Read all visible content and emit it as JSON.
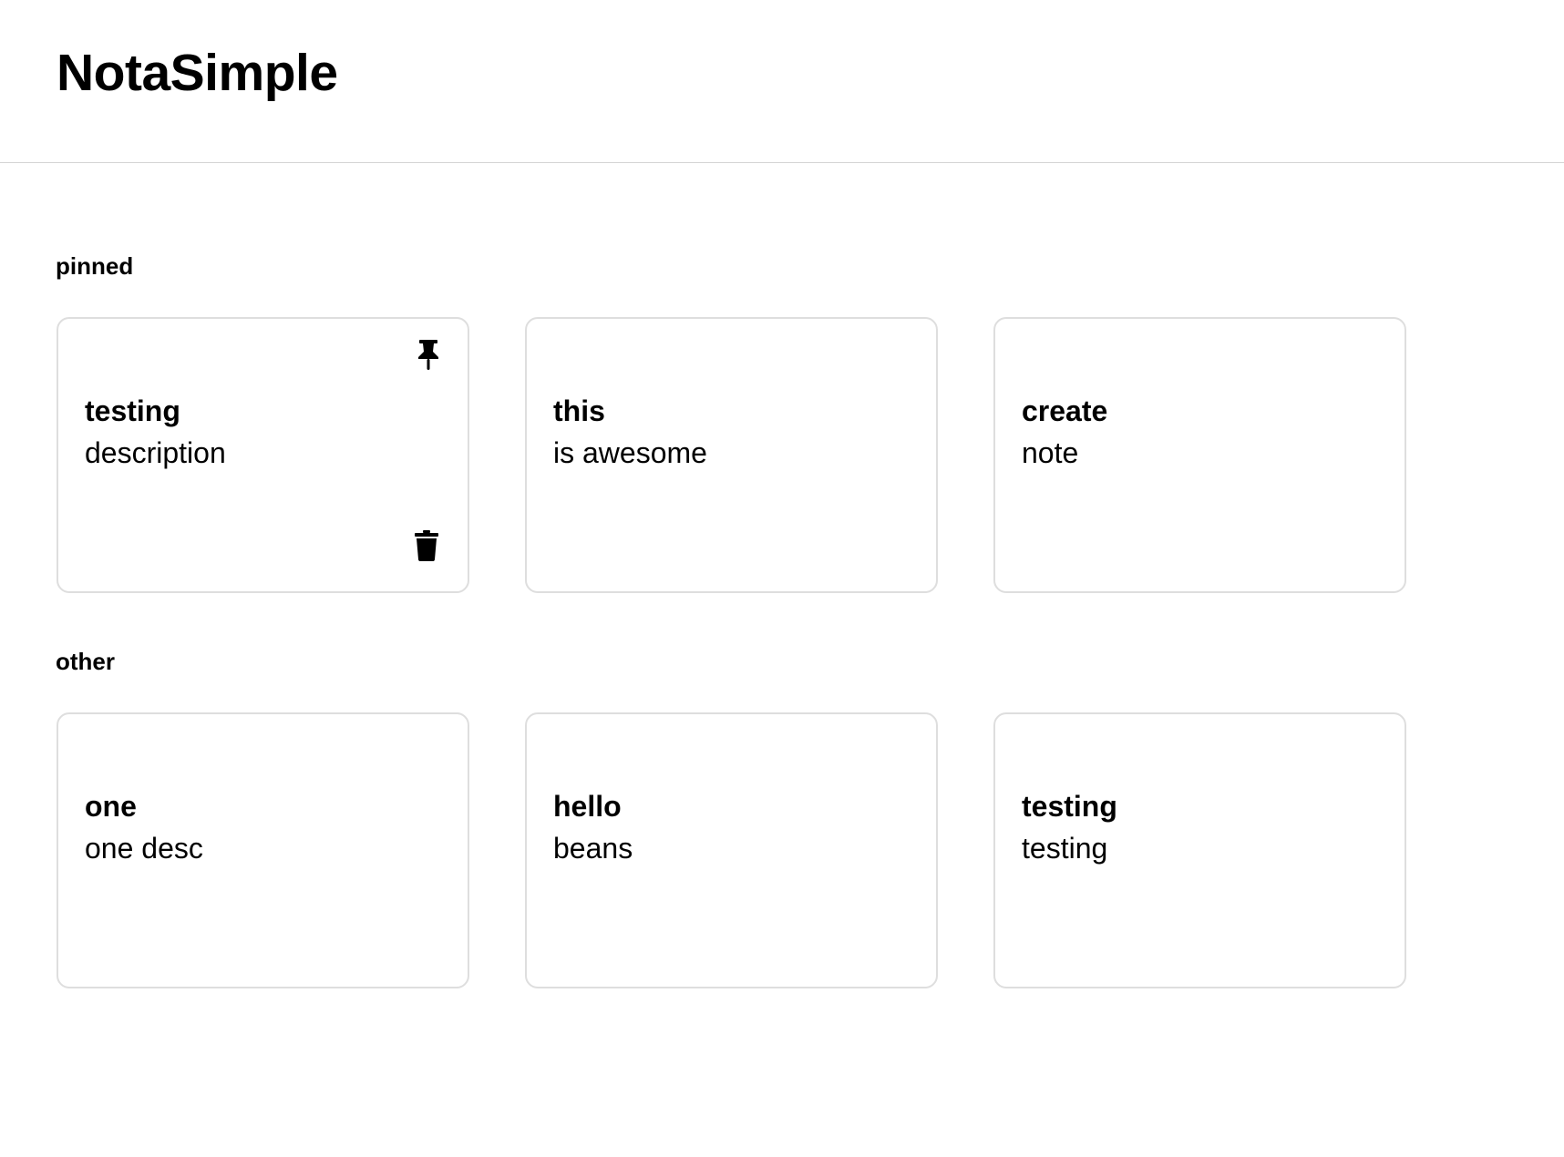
{
  "app": {
    "title": "NotaSimple"
  },
  "sections": {
    "pinned_label": "pinned",
    "other_label": "other"
  },
  "pinned_notes": [
    {
      "title": "testing",
      "description": "description"
    },
    {
      "title": "this",
      "description": "is awesome"
    },
    {
      "title": "create",
      "description": "note"
    }
  ],
  "other_notes": [
    {
      "title": "one",
      "description": "one desc"
    },
    {
      "title": "hello",
      "description": "beans"
    },
    {
      "title": "testing",
      "description": "testing"
    }
  ],
  "icons": {
    "pin": "pushpin-icon",
    "trash": "trash-icon"
  },
  "colors": {
    "text": "#000000",
    "card_border": "#dedede",
    "divider": "#d4d4d4",
    "background": "#ffffff"
  }
}
